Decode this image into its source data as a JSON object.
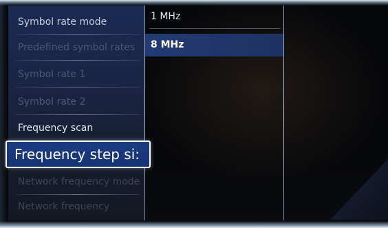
{
  "menu": {
    "items": [
      {
        "label": "Symbol rate mode",
        "state": "enabled"
      },
      {
        "label": "Predefined symbol rates",
        "state": "disabled"
      },
      {
        "label": "Symbol rate 1",
        "state": "disabled"
      },
      {
        "label": "Symbol rate 2",
        "state": "disabled"
      },
      {
        "label": "Frequency scan",
        "state": "enabled"
      },
      {
        "label": "Frequency step si:",
        "state": "focused"
      },
      {
        "label": "Network frequency mode",
        "state": "disabled"
      },
      {
        "label": "Network frequency",
        "state": "disabled"
      }
    ]
  },
  "options": {
    "items": [
      {
        "label": "1 MHz",
        "selected": false
      },
      {
        "label": "8 MHz",
        "selected": true
      }
    ]
  },
  "colors": {
    "menu_bg": "#1a2543",
    "focus_bg": "#1b3c84",
    "focus_border": "#ffffff",
    "selected_option_bg": "#233b72",
    "enabled_text": "#c4ccde",
    "disabled_text": "#4d5873"
  }
}
